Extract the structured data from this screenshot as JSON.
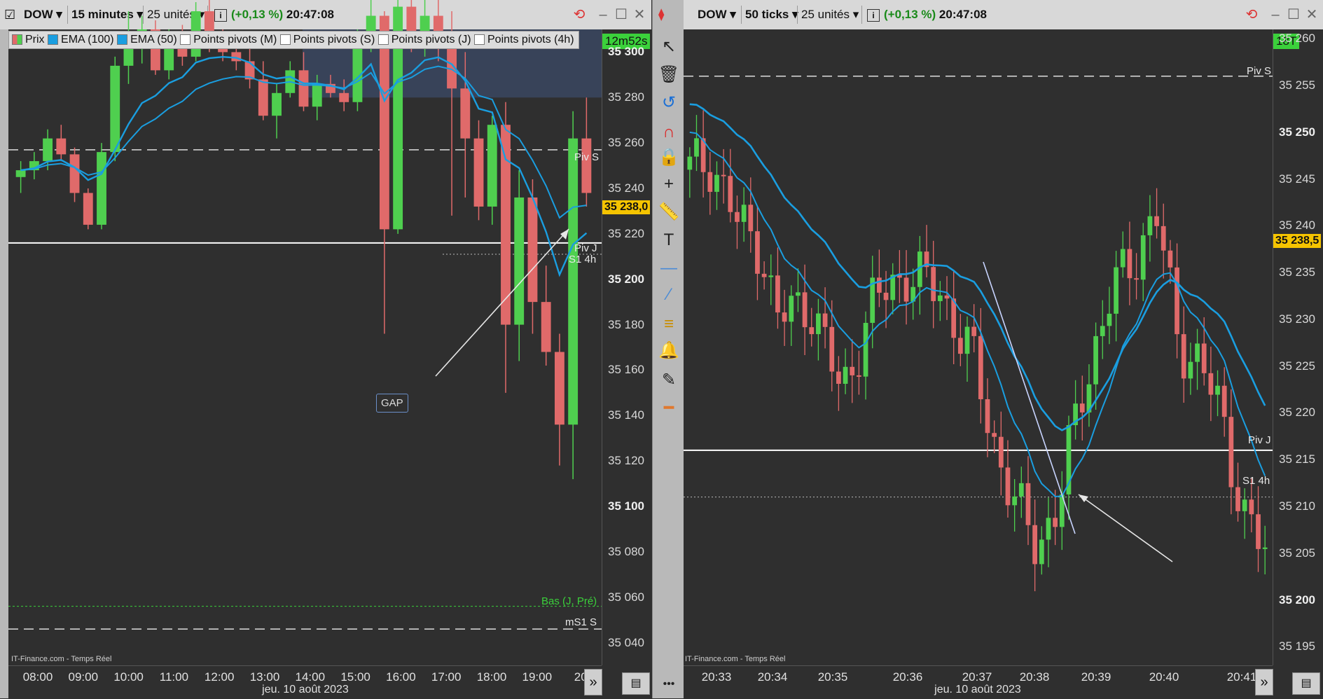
{
  "left": {
    "symbol": "DOW",
    "interval": "15 minutes",
    "units": "25 unités",
    "change": "(+0,13 %)",
    "time": "20:47:08",
    "legend": [
      "Prix",
      "EMA (100)",
      "EMA (50)",
      "Points pivots (M)",
      "Points pivots (S)",
      "Points pivots (J)",
      "Points pivots (4h)"
    ],
    "timer": "12m52s",
    "price_tag": "35 238,0",
    "labels": {
      "piv_s": "Piv S",
      "piv_j": "Piv J",
      "s1_4h": "S1 4h",
      "bas": "Bas (J, Pré)",
      "ms1": "mS1 S",
      "gap": "GAP"
    },
    "source": "IT-Finance.com - Temps Réel",
    "date": "jeu. 10 août 2023",
    "x_ticks": [
      "08:00",
      "09:00",
      "10:00",
      "11:00",
      "12:00",
      "13:00",
      "14:00",
      "15:00",
      "16:00",
      "17:00",
      "18:00",
      "19:00",
      "20:"
    ],
    "y_ticks": [
      "35 300",
      "35 280",
      "35 260",
      "35 240",
      "35 220",
      "35 200",
      "35 180",
      "35 160",
      "35 140",
      "35 120",
      "35 100",
      "35 080",
      "35 060",
      "35 040"
    ],
    "y_ticks_bold": [
      "35 300",
      "35 200",
      "35 100"
    ]
  },
  "right": {
    "symbol": "DOW",
    "interval": "50 ticks",
    "units": "25 unités",
    "change": "(+0,13 %)",
    "time": "20:47:08",
    "timer": "18T",
    "price_tag": "35 238,5",
    "labels": {
      "piv_s": "Piv S",
      "piv_j": "Piv J",
      "s1_4h": "S1 4h"
    },
    "source": "IT-Finance.com - Temps Réel",
    "date": "jeu. 10 août 2023",
    "x_ticks": [
      "20:33",
      "20:34",
      "20:35",
      "20:36",
      "20:37",
      "20:38",
      "20:39",
      "20:40",
      "20:41"
    ],
    "y_ticks": [
      "35 260",
      "35 255",
      "35 250",
      "35 245",
      "35 240",
      "35 235",
      "35 230",
      "35 225",
      "35 220",
      "35 215",
      "35 210",
      "35 205",
      "35 200",
      "35 195"
    ],
    "y_ticks_bold": [
      "35 250",
      "35 200"
    ]
  },
  "toolbar": {
    "tools": [
      "pointer-icon",
      "trash-icon",
      "undo-icon",
      "magnet-icon",
      "lock-icon",
      "add-point-icon",
      "ruler-icon",
      "text-icon",
      "line-icon",
      "segment-icon",
      "fibonacci-icon",
      "alert-icon",
      "pencil-icon",
      "brush-icon",
      "more-icon"
    ]
  },
  "colors": {
    "bull": "#4fcf4f",
    "bear": "#e06a6a",
    "ema": "#1a9ee0",
    "background": "#2f2f2f",
    "price_tag": "#f5c400",
    "timer": "#3bd13b",
    "bas_label": "#3bd13b"
  },
  "chart_data": [
    {
      "type": "candlestick",
      "title": "DOW 15 minutes",
      "x_ticks": [
        "08:00",
        "09:00",
        "10:00",
        "11:00",
        "12:00",
        "13:00",
        "14:00",
        "15:00",
        "16:00",
        "17:00",
        "18:00",
        "19:00",
        "20:"
      ],
      "ylim": [
        35030,
        35310
      ],
      "levels": [
        {
          "name": "Piv S",
          "value": 35257
        },
        {
          "name": "Piv J",
          "value": 35216
        },
        {
          "name": "S1 4h",
          "value": 35211
        },
        {
          "name": "Bas (J, Pré)",
          "value": 35056
        },
        {
          "name": "mS1 S",
          "value": 35046
        }
      ],
      "last_price": 35238.0,
      "candles": [
        [
          35245,
          35252,
          35238,
          35248
        ],
        [
          35248,
          35256,
          35244,
          35252
        ],
        [
          35252,
          35266,
          35248,
          35262
        ],
        [
          35262,
          35268,
          35252,
          35255
        ],
        [
          35255,
          35258,
          35234,
          35238
        ],
        [
          35238,
          35240,
          35222,
          35224
        ],
        [
          35224,
          35260,
          35222,
          35256
        ],
        [
          35256,
          35298,
          35252,
          35294
        ],
        [
          35294,
          35318,
          35286,
          35308
        ],
        [
          35308,
          35316,
          35295,
          35310
        ],
        [
          35310,
          35314,
          35290,
          35292
        ],
        [
          35292,
          35310,
          35288,
          35306
        ],
        [
          35306,
          35312,
          35294,
          35298
        ],
        [
          35298,
          35322,
          35296,
          35318
        ],
        [
          35318,
          35324,
          35300,
          35304
        ],
        [
          35304,
          35310,
          35296,
          35300
        ],
        [
          35300,
          35308,
          35292,
          35296
        ],
        [
          35296,
          35306,
          35284,
          35288
        ],
        [
          35288,
          35296,
          35270,
          35272
        ],
        [
          35272,
          35286,
          35262,
          35282
        ],
        [
          35282,
          35296,
          35280,
          35292
        ],
        [
          35292,
          35300,
          35274,
          35276
        ],
        [
          35276,
          35290,
          35270,
          35286
        ],
        [
          35286,
          35290,
          35280,
          35282
        ],
        [
          35282,
          35288,
          35274,
          35278
        ],
        [
          35278,
          35310,
          35274,
          35306
        ],
        [
          35306,
          35324,
          35300,
          35316
        ],
        [
          35316,
          35318,
          35176,
          35222
        ],
        [
          35222,
          35326,
          35220,
          35320
        ],
        [
          35320,
          35324,
          35300,
          35302
        ],
        [
          35302,
          35324,
          35298,
          35316
        ],
        [
          35316,
          35330,
          35296,
          35302
        ],
        [
          35302,
          35318,
          35228,
          35284
        ],
        [
          35284,
          35300,
          35236,
          35262
        ],
        [
          35262,
          35270,
          35226,
          35232
        ],
        [
          35232,
          35272,
          35224,
          35268
        ],
        [
          35268,
          35278,
          35150,
          35180
        ],
        [
          35180,
          35248,
          35164,
          35236
        ],
        [
          35236,
          35244,
          35176,
          35190
        ],
        [
          35190,
          35206,
          35162,
          35168
        ],
        [
          35168,
          35176,
          35118,
          35136
        ],
        [
          35136,
          35274,
          35112,
          35262
        ],
        [
          35262,
          35280,
          35232,
          35238
        ]
      ]
    },
    {
      "type": "candlestick",
      "title": "DOW 50 ticks",
      "x_ticks": [
        "20:33",
        "20:34",
        "20:35",
        "20:36",
        "20:37",
        "20:38",
        "20:39",
        "20:40",
        "20:41"
      ],
      "ylim": [
        35193,
        35261
      ],
      "levels": [
        {
          "name": "Piv S",
          "value": 35256
        },
        {
          "name": "Piv J",
          "value": 35216
        },
        {
          "name": "S1 4h",
          "value": 35211
        }
      ],
      "last_price": 35238.5
    }
  ]
}
